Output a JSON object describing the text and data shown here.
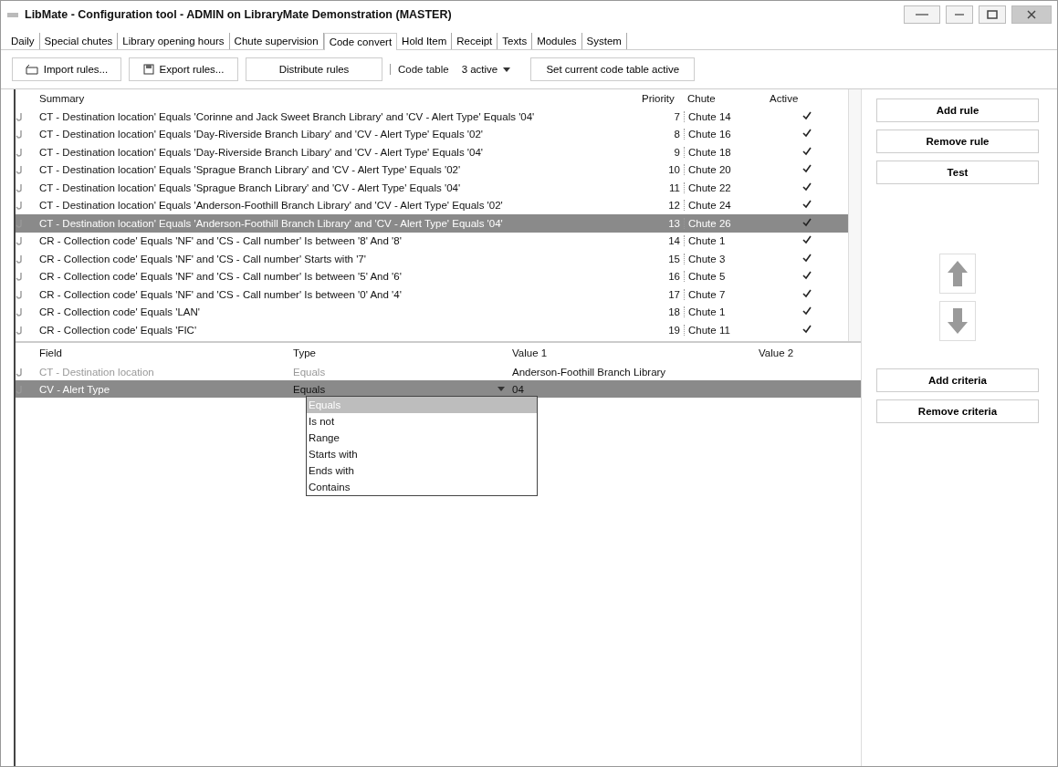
{
  "window": {
    "title": "LibMate - Configuration tool - ADMIN on LibraryMate Demonstration (MASTER)"
  },
  "tabs": [
    {
      "label": "Daily",
      "selected": false
    },
    {
      "label": "Special chutes",
      "selected": false
    },
    {
      "label": "Library opening hours",
      "selected": false
    },
    {
      "label": "Chute supervision",
      "selected": false
    },
    {
      "label": "Code convert",
      "selected": true
    },
    {
      "label": "Hold Item",
      "selected": false
    },
    {
      "label": "Receipt",
      "selected": false
    },
    {
      "label": "Texts",
      "selected": false
    },
    {
      "label": "Modules",
      "selected": false
    },
    {
      "label": "System",
      "selected": false
    }
  ],
  "toolbar": {
    "buttons": [
      {
        "label": "Import rules...",
        "kind": "import"
      },
      {
        "label": "Export rules...",
        "kind": "export"
      },
      {
        "label": "Distribute rules",
        "kind": "plain"
      }
    ],
    "code_table": {
      "label": "Code table",
      "value": "3 active"
    },
    "set_active_button": "Set current code table active"
  },
  "rules": {
    "columns": [
      "Summary",
      "Priority",
      "Chute",
      "Active"
    ],
    "rows": [
      {
        "summary": "CT - Destination location' Equals 'Corinne and Jack Sweet Branch Library' and 'CV - Alert Type' Equals '04'",
        "priority": "7",
        "chute": "Chute 14",
        "active": true,
        "selected": false
      },
      {
        "summary": "CT - Destination location' Equals 'Day-Riverside Branch Libary' and 'CV - Alert Type' Equals '02'",
        "priority": "8",
        "chute": "Chute 16",
        "active": true,
        "selected": false
      },
      {
        "summary": "CT - Destination location' Equals 'Day-Riverside Branch Libary' and 'CV - Alert Type' Equals '04'",
        "priority": "9",
        "chute": "Chute 18",
        "active": true,
        "selected": false
      },
      {
        "summary": "CT - Destination location' Equals 'Sprague Branch Library' and 'CV - Alert Type' Equals '02'",
        "priority": "10",
        "chute": "Chute 20",
        "active": true,
        "selected": false
      },
      {
        "summary": "CT - Destination location' Equals 'Sprague Branch Library' and 'CV - Alert Type' Equals '04'",
        "priority": "11",
        "chute": "Chute 22",
        "active": true,
        "selected": false
      },
      {
        "summary": "CT - Destination location' Equals 'Anderson-Foothill Branch Library' and 'CV - Alert Type' Equals '02'",
        "priority": "12",
        "chute": "Chute 24",
        "active": true,
        "selected": false
      },
      {
        "summary": "CT - Destination location' Equals 'Anderson-Foothill Branch Library' and 'CV - Alert Type' Equals '04'",
        "priority": "13",
        "chute": "Chute 26",
        "active": true,
        "selected": true
      },
      {
        "summary": "CR - Collection code' Equals 'NF' and 'CS - Call number' Is between '8' And '8'",
        "priority": "14",
        "chute": "Chute 1",
        "active": true,
        "selected": false
      },
      {
        "summary": "CR - Collection code' Equals 'NF' and 'CS - Call number' Starts with '7'",
        "priority": "15",
        "chute": "Chute 3",
        "active": true,
        "selected": false
      },
      {
        "summary": "CR - Collection code' Equals 'NF' and 'CS - Call number' Is between '5' And '6'",
        "priority": "16",
        "chute": "Chute 5",
        "active": true,
        "selected": false
      },
      {
        "summary": "CR - Collection code' Equals 'NF' and 'CS - Call number' Is between '0' And '4'",
        "priority": "17",
        "chute": "Chute 7",
        "active": true,
        "selected": false
      },
      {
        "summary": "CR - Collection code' Equals 'LAN'",
        "priority": "18",
        "chute": "Chute 1",
        "active": true,
        "selected": false
      },
      {
        "summary": "CR - Collection code' Equals 'FIC'",
        "priority": "19",
        "chute": "Chute 11",
        "active": true,
        "selected": false
      }
    ]
  },
  "rule_buttons": [
    "Add rule",
    "Remove rule",
    "Test"
  ],
  "criteria": {
    "columns": [
      "Field",
      "Type",
      "Value 1",
      "Value 2"
    ],
    "rows": [
      {
        "field": "CT - Destination location",
        "type": "Equals",
        "value_1": "Anderson-Foothill Branch Library",
        "selected": false
      },
      {
        "field": "CV - Alert Type",
        "type": "Equals",
        "value_1": "04",
        "selected": true
      }
    ],
    "dropdown_options": [
      {
        "label": "Equals",
        "selected": true
      },
      {
        "label": "Is not",
        "selected": false
      },
      {
        "label": "Range",
        "selected": false
      },
      {
        "label": "Starts with",
        "selected": false
      },
      {
        "label": "Ends with",
        "selected": false
      },
      {
        "label": "Contains",
        "selected": false
      }
    ]
  },
  "criteria_buttons": [
    "Add criteria",
    "Remove criteria"
  ]
}
